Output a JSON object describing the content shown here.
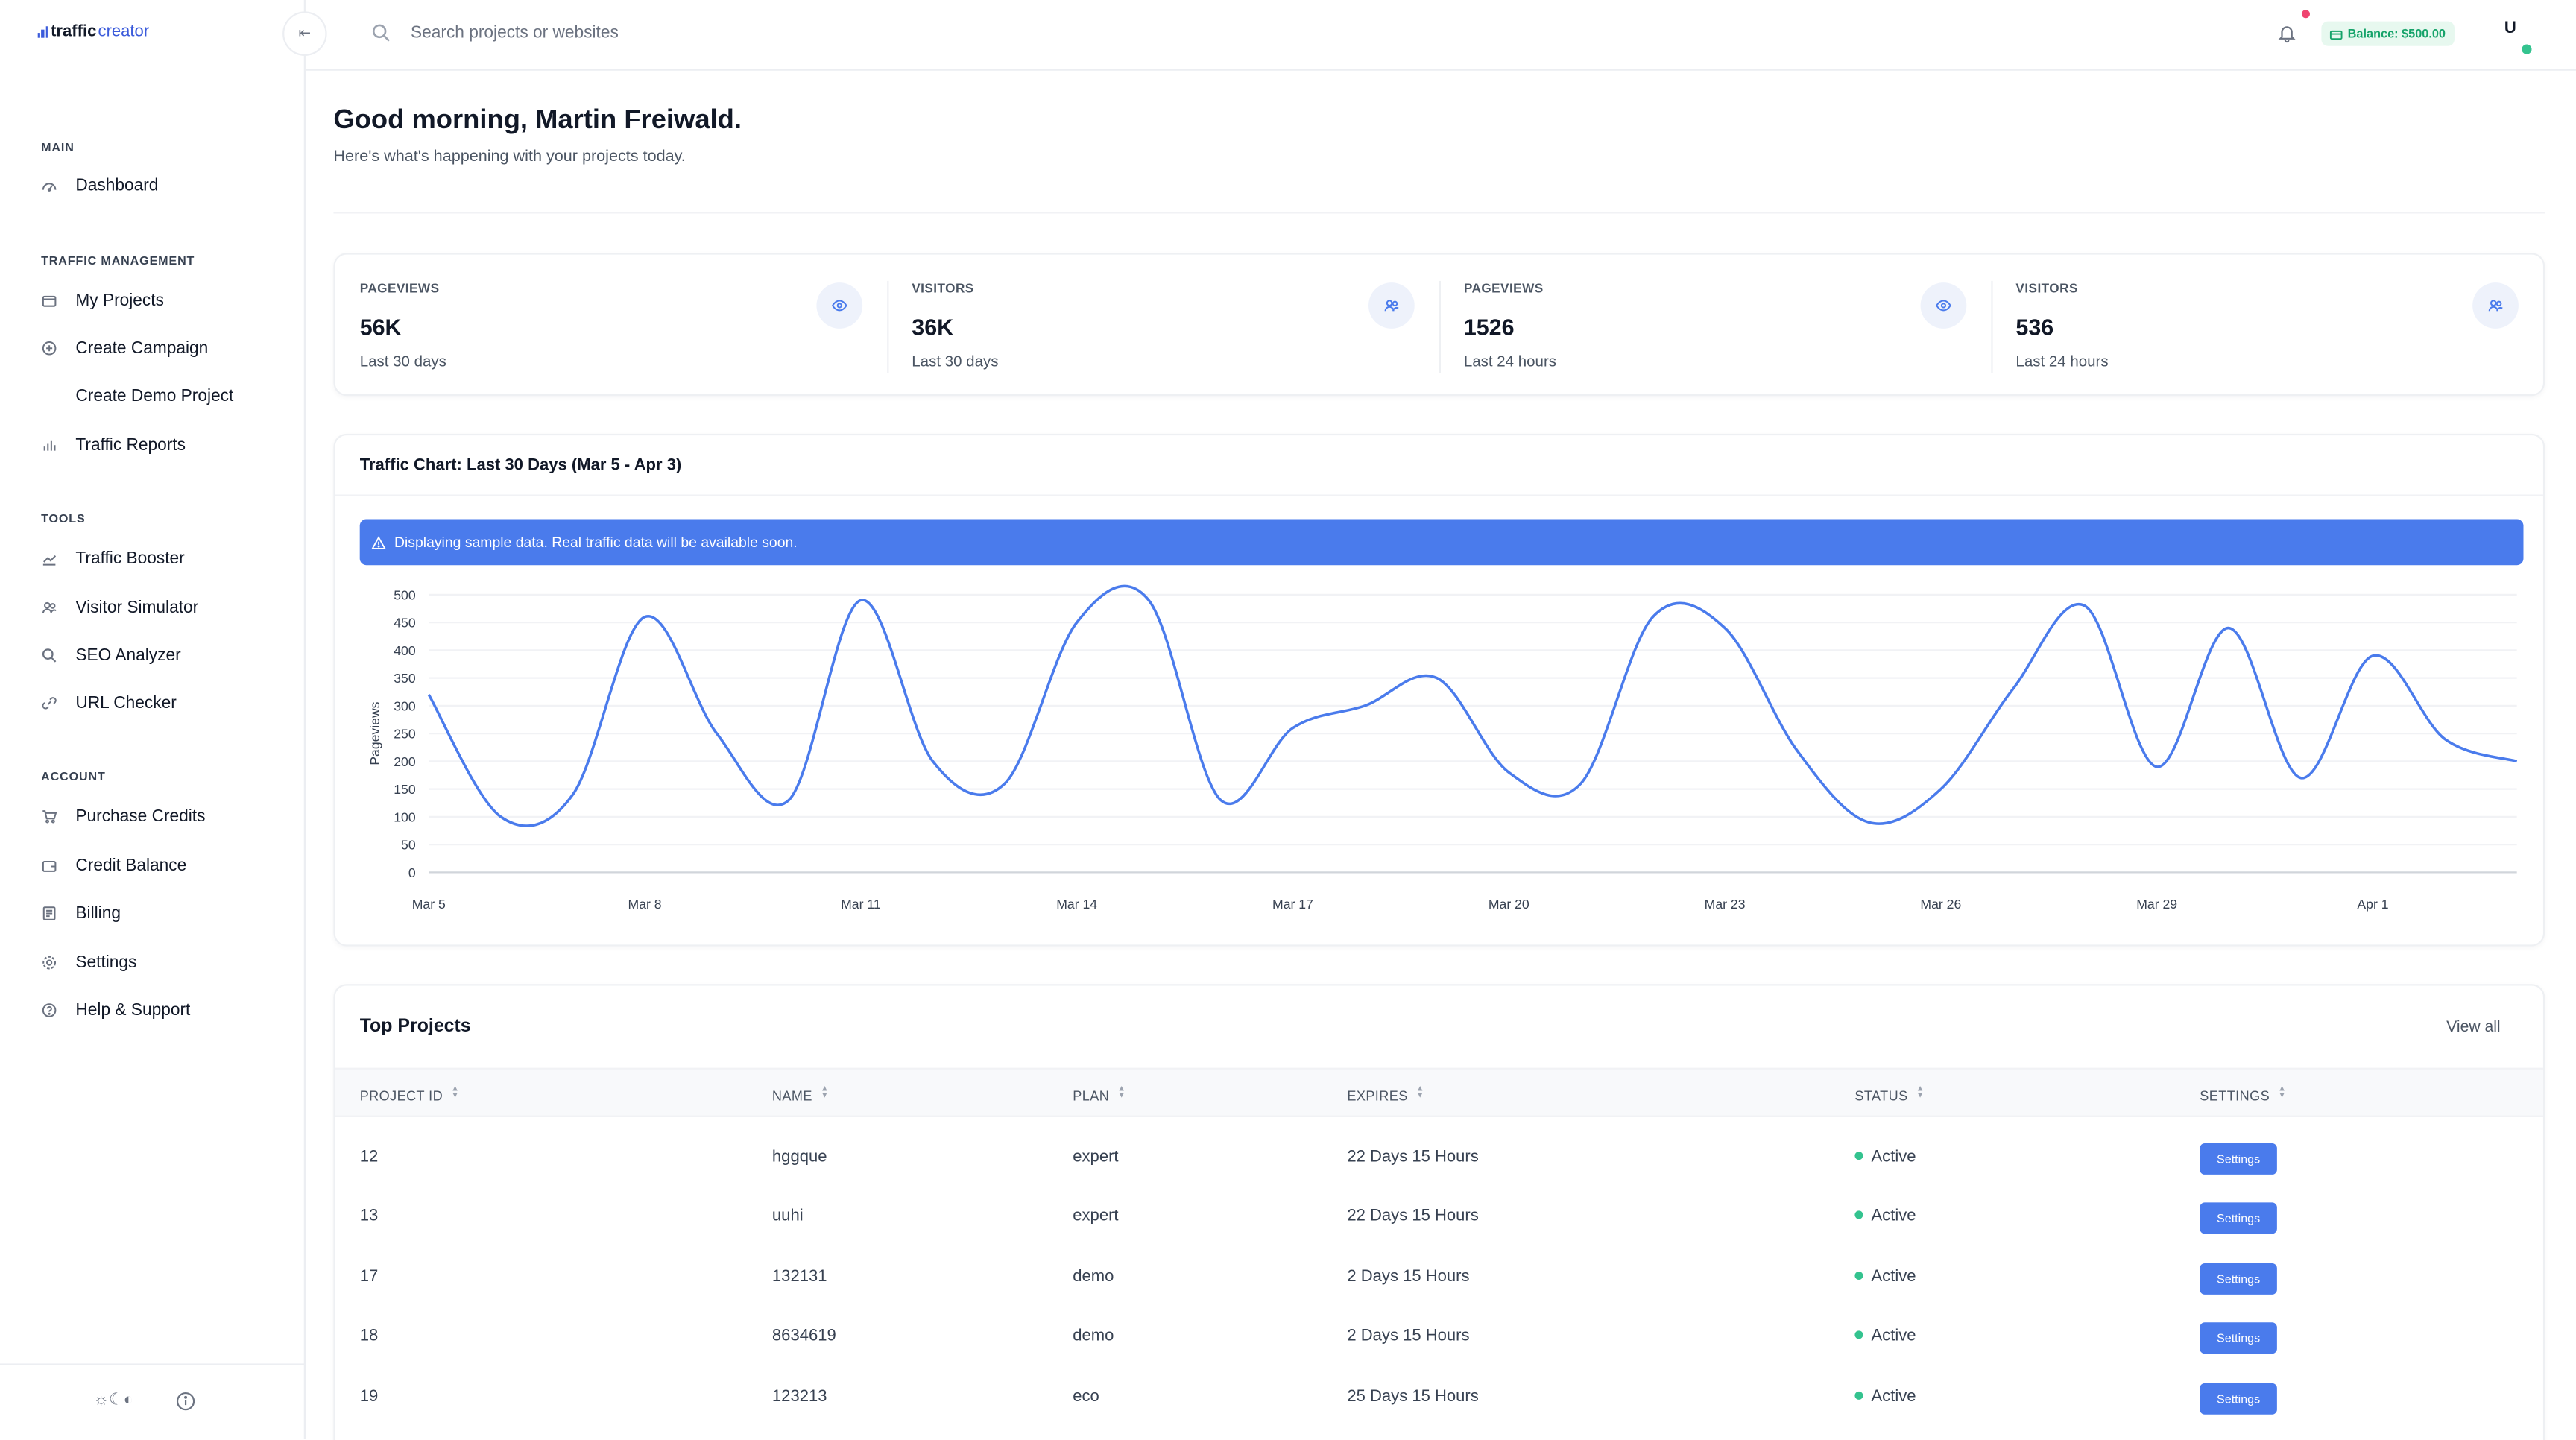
{
  "brand": {
    "name_bold": "traffic",
    "name_light": "creator"
  },
  "search": {
    "placeholder": "Search projects or websites"
  },
  "topbar": {
    "balance": "Balance: $500.00",
    "avatar_initial": "U"
  },
  "sidebar": {
    "sections": [
      {
        "title": "MAIN",
        "items": [
          {
            "label": "Dashboard",
            "icon": "dashboard-icon"
          }
        ]
      },
      {
        "title": "TRAFFIC MANAGEMENT",
        "items": [
          {
            "label": "My Projects",
            "icon": "folder-icon"
          },
          {
            "label": "Create Campaign",
            "icon": "plus-circle-icon"
          },
          {
            "label": "Create Demo Project",
            "icon": ""
          },
          {
            "label": "Traffic Reports",
            "icon": "bar-chart-icon"
          }
        ]
      },
      {
        "title": "TOOLS",
        "items": [
          {
            "label": "Traffic Booster",
            "icon": "trend-up-icon"
          },
          {
            "label": "Visitor Simulator",
            "icon": "users-icon"
          },
          {
            "label": "SEO Analyzer",
            "icon": "search-icon"
          },
          {
            "label": "URL Checker",
            "icon": "link-icon"
          }
        ]
      },
      {
        "title": "ACCOUNT",
        "items": [
          {
            "label": "Purchase Credits",
            "icon": "cart-icon"
          },
          {
            "label": "Credit Balance",
            "icon": "wallet-icon"
          },
          {
            "label": "Billing",
            "icon": "receipt-icon"
          },
          {
            "label": "Settings",
            "icon": "gear-icon"
          },
          {
            "label": "Help & Support",
            "icon": "help-icon"
          }
        ]
      }
    ]
  },
  "header": {
    "greeting": "Good morning, Martin Freiwald.",
    "subtitle": "Here's what's happening with your projects today."
  },
  "stats": [
    {
      "label": "PAGEVIEWS",
      "value": "56K",
      "period": "Last 30 days",
      "icon": "eye-icon"
    },
    {
      "label": "VISITORS",
      "value": "36K",
      "period": "Last 30 days",
      "icon": "users-icon"
    },
    {
      "label": "PAGEVIEWS",
      "value": "1526",
      "period": "Last 24 hours",
      "icon": "eye-icon"
    },
    {
      "label": "VISITORS",
      "value": "536",
      "period": "Last 24 hours",
      "icon": "users-icon"
    }
  ],
  "chart": {
    "title": "Traffic Chart: Last 30 Days (Mar 5 - Apr 3)",
    "alert": "Displaying sample data. Real traffic data will be available soon."
  },
  "chart_data": {
    "type": "line",
    "ylabel": "Pageviews",
    "xlabel": "",
    "ylim": [
      0,
      500
    ],
    "yticks": [
      0,
      50,
      100,
      150,
      200,
      250,
      300,
      350,
      400,
      450,
      500
    ],
    "xticks": [
      "Mar 5",
      "Mar 8",
      "Mar 11",
      "Mar 14",
      "Mar 17",
      "Mar 20",
      "Mar 23",
      "Mar 26",
      "Mar 29",
      "Apr 1"
    ],
    "grid": true,
    "color": "#4a7bec",
    "x": [
      "Mar 5",
      "Mar 6",
      "Mar 7",
      "Mar 8",
      "Mar 9",
      "Mar 10",
      "Mar 11",
      "Mar 12",
      "Mar 13",
      "Mar 14",
      "Mar 15",
      "Mar 16",
      "Mar 17",
      "Mar 18",
      "Mar 19",
      "Mar 20",
      "Mar 21",
      "Mar 22",
      "Mar 23",
      "Mar 24",
      "Mar 25",
      "Mar 26",
      "Mar 27",
      "Mar 28",
      "Mar 29",
      "Mar 30",
      "Mar 31",
      "Apr 1",
      "Apr 2",
      "Apr 3"
    ],
    "series": [
      {
        "values": [
          320,
          100,
          140,
          460,
          250,
          130,
          490,
          200,
          160,
          450,
          490,
          130,
          260,
          300,
          350,
          180,
          160,
          460,
          440,
          220,
          90,
          150,
          330,
          480,
          190,
          440,
          170,
          390,
          240,
          200
        ]
      }
    ]
  },
  "projects": {
    "title": "Top Projects",
    "view_all": "View all",
    "columns": [
      "PROJECT ID",
      "NAME",
      "PLAN",
      "EXPIRES",
      "STATUS",
      "SETTINGS"
    ],
    "rows": [
      {
        "id": "12",
        "name": "hggque",
        "plan": "expert",
        "expires": "22 Days 15 Hours",
        "status": "Active",
        "action": "Settings"
      },
      {
        "id": "13",
        "name": "uuhi",
        "plan": "expert",
        "expires": "22 Days 15 Hours",
        "status": "Active",
        "action": "Settings"
      },
      {
        "id": "17",
        "name": "132131",
        "plan": "demo",
        "expires": "2 Days 15 Hours",
        "status": "Active",
        "action": "Settings"
      },
      {
        "id": "18",
        "name": "8634619",
        "plan": "demo",
        "expires": "2 Days 15 Hours",
        "status": "Active",
        "action": "Settings"
      },
      {
        "id": "19",
        "name": "123213",
        "plan": "eco",
        "expires": "25 Days 15 Hours",
        "status": "Active",
        "action": "Settings"
      }
    ]
  },
  "colors": {
    "accent": "#4a7bec",
    "brand": "#3b5bdb",
    "success": "#34c38f",
    "balance_bg": "#e7f8ef",
    "notification": "#ef4470"
  }
}
